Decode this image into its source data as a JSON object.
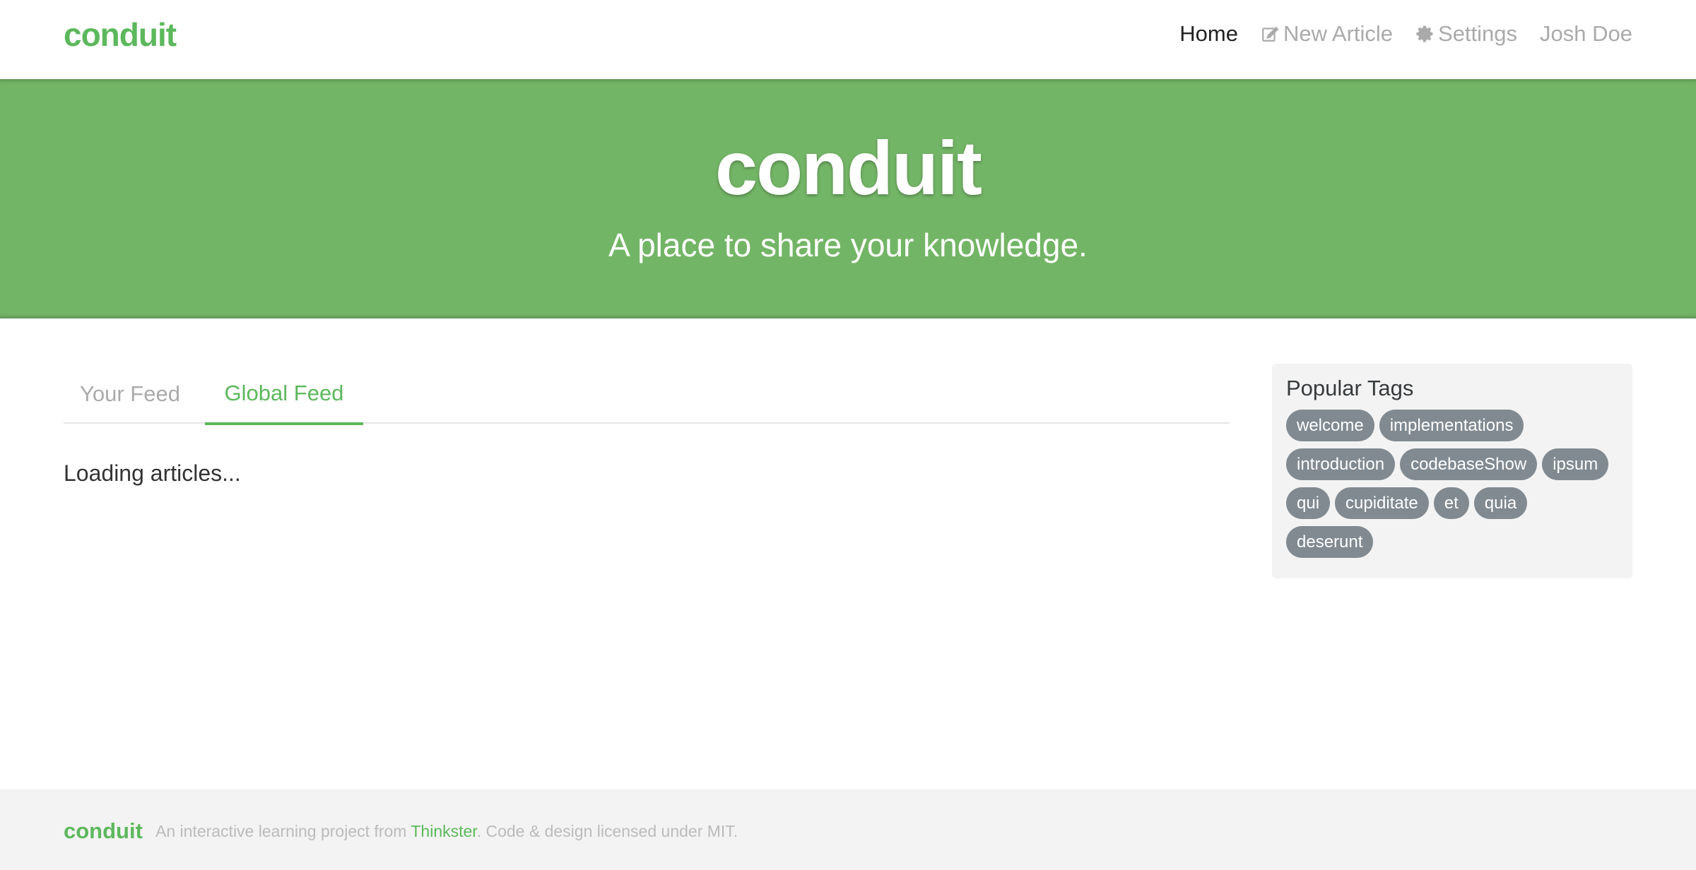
{
  "navbar": {
    "brand": "conduit",
    "links": [
      {
        "label": "Home",
        "icon": ""
      },
      {
        "label": "New Article",
        "icon": "edit-icon"
      },
      {
        "label": "Settings",
        "icon": "gear-icon"
      },
      {
        "label": "Josh Doe",
        "icon": ""
      }
    ]
  },
  "banner": {
    "title": "conduit",
    "subtitle": "A place to share your knowledge."
  },
  "feed": {
    "tabs": [
      {
        "label": "Your Feed"
      },
      {
        "label": "Global Feed"
      }
    ],
    "active_tab": "Global Feed",
    "loading_text": "Loading articles..."
  },
  "sidebar": {
    "title": "Popular Tags",
    "tags": [
      "welcome",
      "implementations",
      "introduction",
      "codebaseShow",
      "ipsum",
      "qui",
      "cupiditate",
      "et",
      "quia",
      "deserunt"
    ]
  },
  "footer": {
    "brand": "conduit",
    "text_before": "An interactive learning project from ",
    "link": "Thinkster",
    "text_after": ". Code & design licensed under MIT."
  },
  "colors": {
    "accent": "#5cb85c",
    "banner": "#73b566",
    "tag_bg": "#818a91",
    "sidebar_bg": "#f3f3f3"
  }
}
